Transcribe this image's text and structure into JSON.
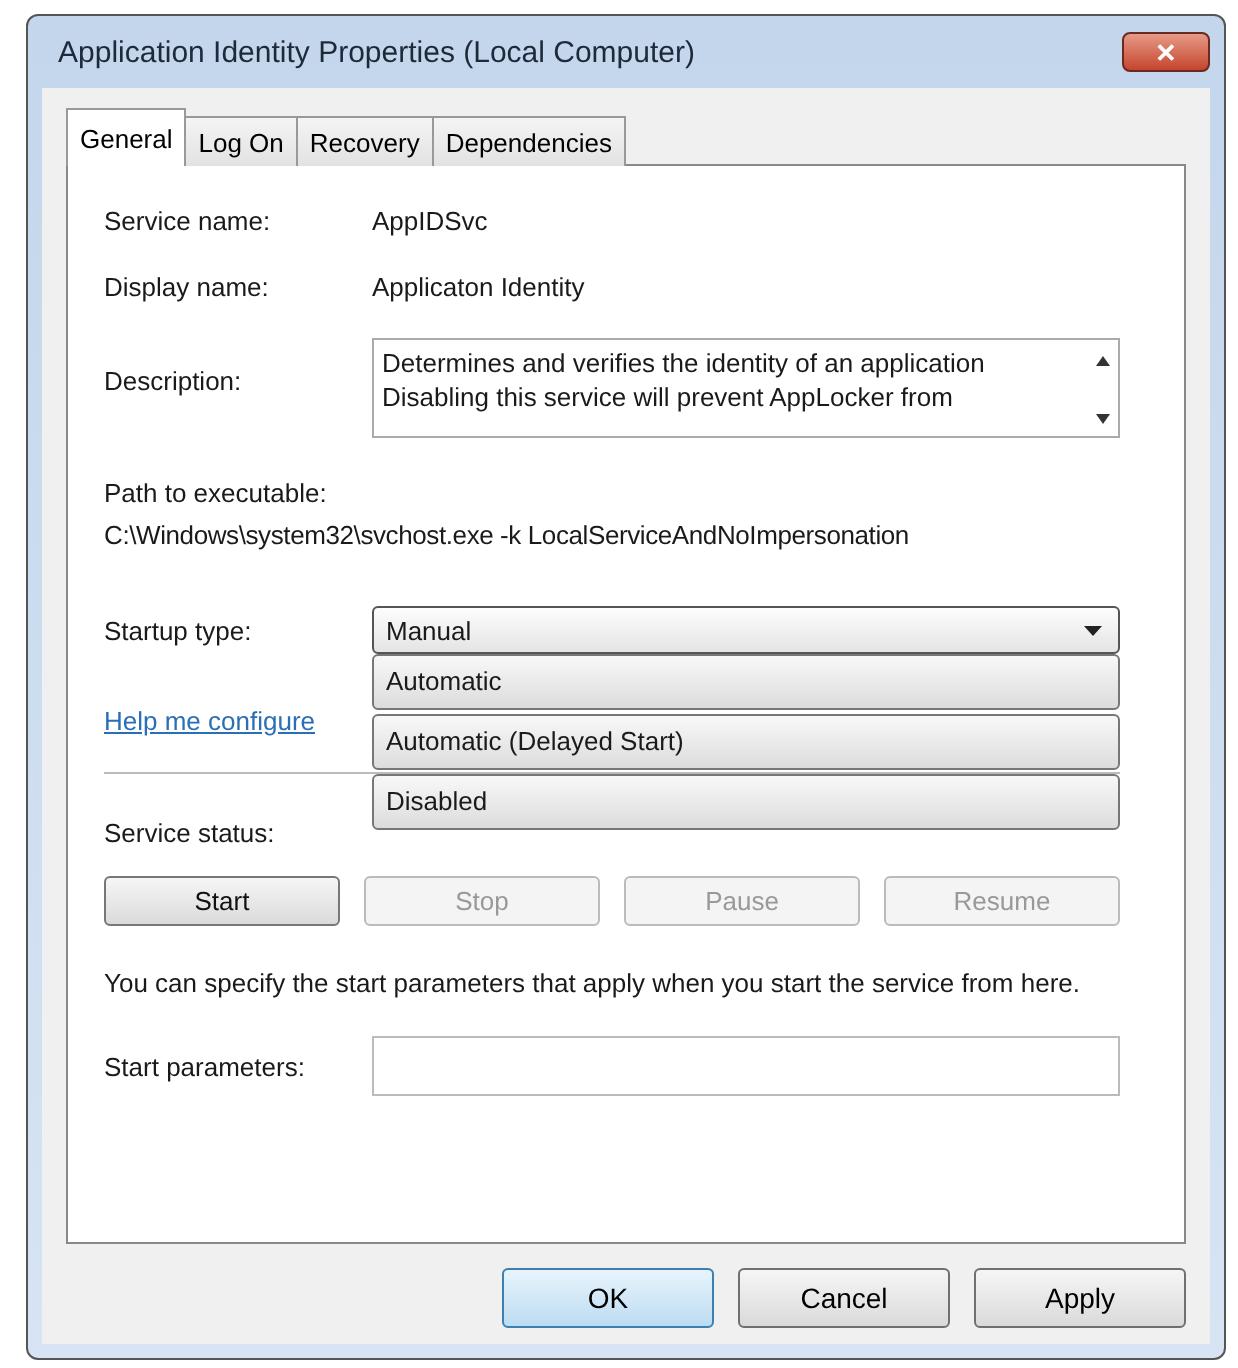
{
  "window": {
    "title": "Application Identity Properties (Local Computer)",
    "close": "✕"
  },
  "tabs": [
    {
      "label": "General",
      "selected": true
    },
    {
      "label": "Log On",
      "selected": false
    },
    {
      "label": "Recovery",
      "selected": false
    },
    {
      "label": "Dependencies",
      "selected": false
    }
  ],
  "fields": [
    {
      "label": "Service name:",
      "value": "AppIDSvc"
    },
    {
      "label": "Display name:",
      "value": "Applicaton Identity"
    }
  ],
  "description": {
    "label": "Description:",
    "lines": [
      "Determines and verifies the identity of an application",
      "Disabling this service will prevent AppLocker from"
    ]
  },
  "path": {
    "label": "Path to executable:",
    "value": "C:\\Windows\\system32\\svchost.exe -k LocalServiceAndNoImpersonation"
  },
  "startup_type": {
    "label": "Startup type:",
    "value": "Manual",
    "expanded": true,
    "options": [
      {
        "label": "Automatic",
        "selected": false
      },
      {
        "label": "Automatic (Delayed Start)",
        "selected": false
      },
      {
        "label": "Disabled",
        "selected": false
      }
    ]
  },
  "help_link": "Help me configure",
  "service_status": {
    "label": "Service status:"
  },
  "service_buttons": [
    {
      "label": "Start",
      "disabled": false
    },
    {
      "label": "Stop",
      "disabled": true
    },
    {
      "label": "Pause",
      "disabled": true
    },
    {
      "label": "Resume",
      "disabled": true
    }
  ],
  "note": "You can specify the start parameters that apply when you start the service from here.",
  "start_parameters": {
    "label": "Start parameters:"
  },
  "buttons": [
    {
      "label": "OK",
      "default": true
    },
    {
      "label": "Cancel",
      "default": false
    },
    {
      "label": "Apply",
      "default": false
    }
  ]
}
